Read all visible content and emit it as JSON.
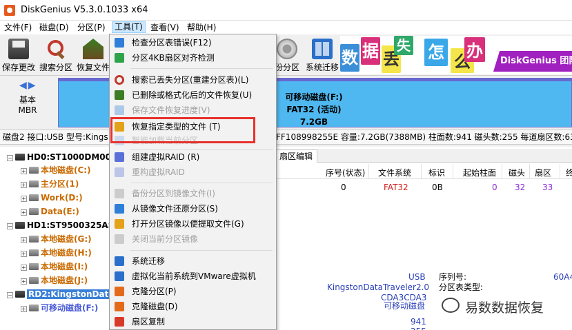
{
  "window": {
    "title": "DiskGenius V5.3.0.1033 x64"
  },
  "menubar": [
    {
      "label": "文件(F)"
    },
    {
      "label": "磁盘(D)"
    },
    {
      "label": "分区(P)"
    },
    {
      "label": "工具(T)"
    },
    {
      "label": "查看(V)"
    },
    {
      "label": "帮助(H)"
    }
  ],
  "toolbar": [
    {
      "label": "保存更改",
      "icon": "save-icon"
    },
    {
      "label": "搜索分区",
      "icon": "search-icon"
    },
    {
      "label": "恢复文件",
      "icon": "recover-icon"
    },
    {
      "label": "份分区",
      "icon": "partition-icon"
    },
    {
      "label": "系统迁移",
      "icon": "migrate-icon"
    }
  ],
  "banner": {
    "tiles": [
      "数",
      "据",
      "丢",
      "失",
      "怎",
      "么",
      "办"
    ],
    "brand": "DiskGenius 团队"
  },
  "disk_nav": {
    "basic": "基本",
    "mbr": "MBR"
  },
  "disk_bar": {
    "name": "可移动磁盘(F:)",
    "fs": "FAT32 (活动)",
    "size": "7.2GB"
  },
  "disk_info": {
    "left": "磁盘2 接口:USB  型号:Kings",
    "right": "FF108998255E  容量:7.2GB(7388MB)  柱面数:941  磁头数:255  每道扇区数:63"
  },
  "tree": [
    {
      "label": "HD0:ST1000DM00",
      "kind": "disk"
    },
    {
      "label": "本地磁盘(C:)",
      "kind": "vol"
    },
    {
      "label": "主分区(1)",
      "kind": "vol"
    },
    {
      "label": "Work(D:)",
      "kind": "vol"
    },
    {
      "label": "Data(E:)",
      "kind": "vol"
    },
    {
      "label": "HD1:ST9500325AS",
      "kind": "disk"
    },
    {
      "label": "本地磁盘(G:)",
      "kind": "vol"
    },
    {
      "label": "本地磁盘(H:)",
      "kind": "vol"
    },
    {
      "label": "本地磁盘(I:)",
      "kind": "vol"
    },
    {
      "label": "本地磁盘(J:)",
      "kind": "vol"
    },
    {
      "label": "RD2:KingstonData",
      "kind": "disk"
    },
    {
      "label": "可移动磁盘(F:)",
      "kind": "vol"
    }
  ],
  "tabs": {
    "edit": "扇区编辑"
  },
  "ptable": {
    "headers": [
      "序号(状态)",
      "文件系统",
      "标识",
      "起始柱面",
      "磁头",
      "扇区",
      "终"
    ],
    "row": [
      "0",
      "FAT32",
      "0B",
      "0",
      "32",
      "33"
    ]
  },
  "props": {
    "interface": "USB",
    "model": "KingstonDataTraveler2.0",
    "id": "CDA3CDA3",
    "type": "可移动磁盘",
    "serial_label": "序列号:",
    "ptype_label": "分区表类型:",
    "serial_value": "60A4",
    "cyl": "941",
    "heads": "255"
  },
  "watermark": "易数数据恢复",
  "tools_menu": [
    {
      "label": "检查分区表错误(F12)",
      "disabled": false,
      "color": "#2f7fd8"
    },
    {
      "label": "分区4KB扇区对齐检测",
      "disabled": false,
      "color": "#2fa34a"
    },
    {
      "sep": true
    },
    {
      "label": "搜索已丢失分区(重建分区表)(L)",
      "disabled": false,
      "color": "#c0392b"
    },
    {
      "label": "已删除或格式化后的文件恢复(U)",
      "disabled": false,
      "color": "#3b7d23"
    },
    {
      "label": "保存文件恢复进度(V)",
      "disabled": true,
      "color": "#2f7fd8"
    },
    {
      "label": "恢复指定类型的文件 (T)",
      "disabled": false,
      "color": "#e3a21a"
    },
    {
      "label": "智能加载当前分区",
      "disabled": true,
      "color": "#2f7fd8"
    },
    {
      "sep": true
    },
    {
      "label": "组建虚拟RAID (R)",
      "disabled": false,
      "color": "#5a6fd8"
    },
    {
      "label": "重构虚拟RAID",
      "disabled": true,
      "color": "#5a6fd8"
    },
    {
      "sep": true
    },
    {
      "label": "备份分区到镜像文件(I)",
      "disabled": true,
      "color": "#888888"
    },
    {
      "label": "从镜像文件还原分区(S)",
      "disabled": false,
      "color": "#2f7fd8"
    },
    {
      "label": "打开分区镜像以便提取文件(G)",
      "disabled": false,
      "color": "#e3a21a"
    },
    {
      "label": "关闭当前分区镜像",
      "disabled": true,
      "color": "#888888"
    },
    {
      "sep": true
    },
    {
      "label": "系统迁移",
      "disabled": false,
      "color": "#2a6fc9"
    },
    {
      "label": "虚拟化当前系统到VMware虚拟机",
      "disabled": false,
      "color": "#2a6fc9"
    },
    {
      "label": "克隆分区(P)",
      "disabled": false,
      "color": "#e36a1a"
    },
    {
      "label": "克隆磁盘(D)",
      "disabled": false,
      "color": "#e36a1a"
    },
    {
      "label": "扇区复制",
      "disabled": false,
      "color": "#d83a2a"
    }
  ],
  "colors": {
    "accent": "#cce8ff",
    "highlight": "#e8302a",
    "diskbar": "#4fb8f0",
    "brand": "#a020c0"
  }
}
